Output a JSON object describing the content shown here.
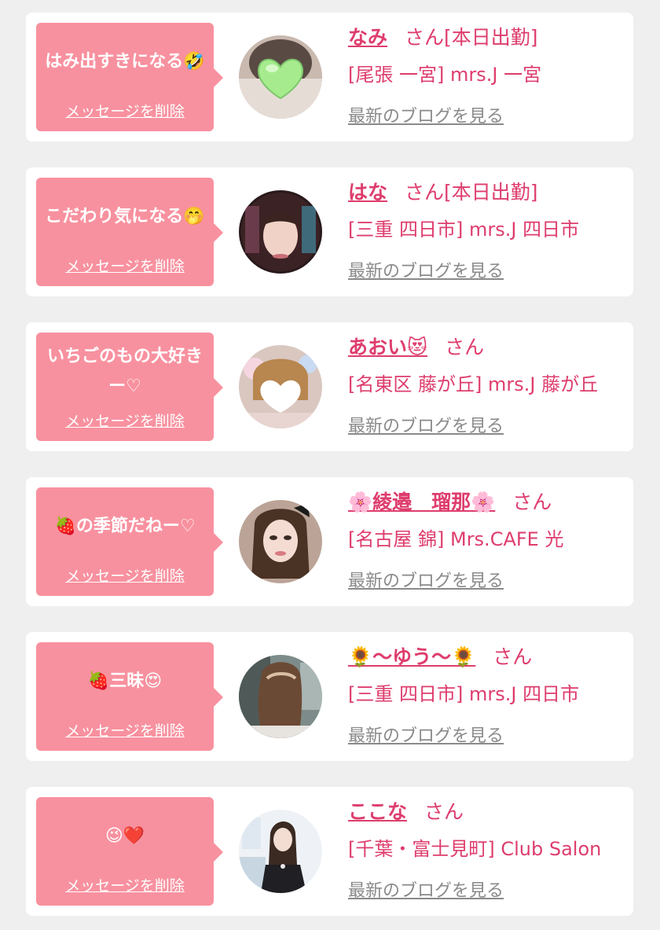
{
  "items": [
    {
      "message": "はみ出すきになる🤣",
      "delete_label": "メッセージを削除",
      "name": "なみ",
      "suffix": "さん[本日出勤]",
      "shop": "[尾張 一宮] mrs.J 一宮",
      "blog_label": "最新のブログを見る",
      "avatar_icon": "profile-photo-heart-sticker"
    },
    {
      "message": "こだわり気になる🤭",
      "delete_label": "メッセージを削除",
      "name": "はな",
      "suffix": "さん[本日出勤]",
      "shop": "[三重 四日市] mrs.J 四日市",
      "blog_label": "最新のブログを見る",
      "avatar_icon": "profile-photo"
    },
    {
      "message": "いちごのもの大好きー♡",
      "delete_label": "メッセージを削除",
      "name": "あおい😻",
      "suffix": "さん",
      "shop": "[名東区 藤が丘] mrs.J 藤が丘",
      "blog_label": "最新のブログを見る",
      "avatar_icon": "profile-photo-heart-sticker"
    },
    {
      "message": "🍓の季節だねー♡",
      "delete_label": "メッセージを削除",
      "name": "🌸綾邉　瑠那🌸",
      "suffix": "さん",
      "shop": "[名古屋 錦] Mrs.CAFE 光",
      "blog_label": "最新のブログを見る",
      "avatar_icon": "profile-photo"
    },
    {
      "message": "🍓三昧😍",
      "delete_label": "メッセージを削除",
      "name": "🌻〜ゆう〜🌻",
      "suffix": "さん",
      "shop": "[三重 四日市] mrs.J 四日市",
      "blog_label": "最新のブログを見る",
      "avatar_icon": "profile-photo"
    },
    {
      "message": "😉❤️",
      "delete_label": "メッセージを削除",
      "name": "ここな",
      "suffix": "さん",
      "shop": "[千葉・富士見町] Club Salon",
      "blog_label": "最新のブログを見る",
      "avatar_icon": "profile-photo"
    }
  ],
  "colors": {
    "bubble": "#f8919f",
    "accent_text": "#de3d6d",
    "link_gray": "#8a8a8a",
    "page_bg": "#efefef"
  }
}
